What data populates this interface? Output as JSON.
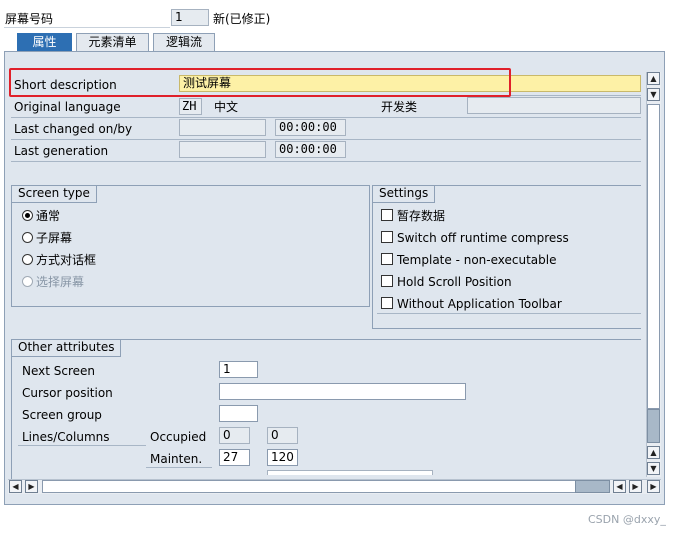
{
  "header": {
    "screen_number_label": "屏幕号码",
    "screen_number_value": "1",
    "status_text": "新(已修正)"
  },
  "tabs": [
    {
      "label": "属性",
      "active": true
    },
    {
      "label": "元素清单",
      "active": false
    },
    {
      "label": "逻辑流",
      "active": false
    }
  ],
  "attributes": {
    "short_description_label": "Short description",
    "short_description_value": "测试屏幕",
    "original_language_label": "Original language",
    "original_language_code": "ZH",
    "original_language_name": "中文",
    "dev_class_label": "开发类",
    "dev_class_value": "",
    "last_changed_label": "Last changed on/by",
    "last_changed_date": "",
    "last_changed_time": "00:00:00",
    "last_generation_label": "Last generation",
    "last_generation_date": "",
    "last_generation_time": "00:00:00"
  },
  "screen_type": {
    "title": "Screen type",
    "options": [
      {
        "label": "通常",
        "selected": true,
        "enabled": true
      },
      {
        "label": "子屏幕",
        "selected": false,
        "enabled": true
      },
      {
        "label": "方式对话框",
        "selected": false,
        "enabled": true
      },
      {
        "label": "选择屏幕",
        "selected": false,
        "enabled": false
      }
    ]
  },
  "settings": {
    "title": "Settings",
    "options": [
      {
        "label": "暂存数据",
        "checked": false
      },
      {
        "label": "Switch off runtime compress",
        "checked": false
      },
      {
        "label": "Template - non-executable",
        "checked": false
      },
      {
        "label": "Hold Scroll Position",
        "checked": false
      },
      {
        "label": "Without Application Toolbar",
        "checked": false
      }
    ]
  },
  "other_attributes": {
    "title": "Other attributes",
    "next_screen_label": "Next Screen",
    "next_screen_value": "1",
    "cursor_position_label": "Cursor position",
    "cursor_position_value": "",
    "screen_group_label": "Screen group",
    "screen_group_value": "",
    "lines_columns_label": "Lines/Columns",
    "occupied_label": "Occupied",
    "occupied_lines": "0",
    "occupied_columns": "0",
    "mainten_label": "Mainten.",
    "mainten_lines": "27",
    "mainten_columns": "120"
  },
  "watermark": "CSDN @dxxy_",
  "colors": {
    "panel_bg": "#dfe6ee",
    "active_tab": "#2d6fb3",
    "highlight_field": "#fdf1a6",
    "annotation_box": "#e0202a"
  }
}
